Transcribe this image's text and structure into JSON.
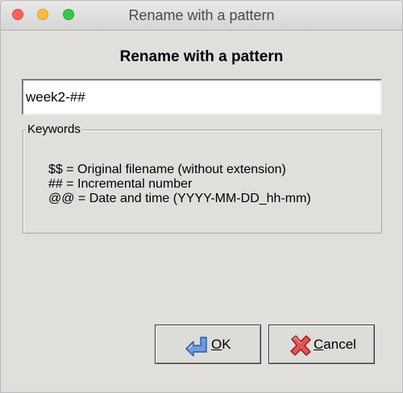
{
  "window": {
    "title": "Rename with a pattern"
  },
  "dialog": {
    "heading": "Rename with a pattern",
    "pattern_value": "week2-##"
  },
  "keywords": {
    "legend": "Keywords",
    "lines": [
      "$$ = Original filename (without extension)",
      "## = Incremental number",
      "@@ = Date and time (YYYY-MM-DD_hh-mm)"
    ]
  },
  "buttons": {
    "ok": {
      "mnemonic": "O",
      "rest": "K",
      "icon": "arrow-left-icon"
    },
    "cancel": {
      "mnemonic": "C",
      "rest": "ancel",
      "icon": "red-x-icon"
    }
  },
  "colors": {
    "close": "#fc605c",
    "minimize": "#fdbc40",
    "maximize": "#34c84a",
    "ok_icon": "#5b8fd6",
    "cancel_icon": "#d93a3a"
  }
}
